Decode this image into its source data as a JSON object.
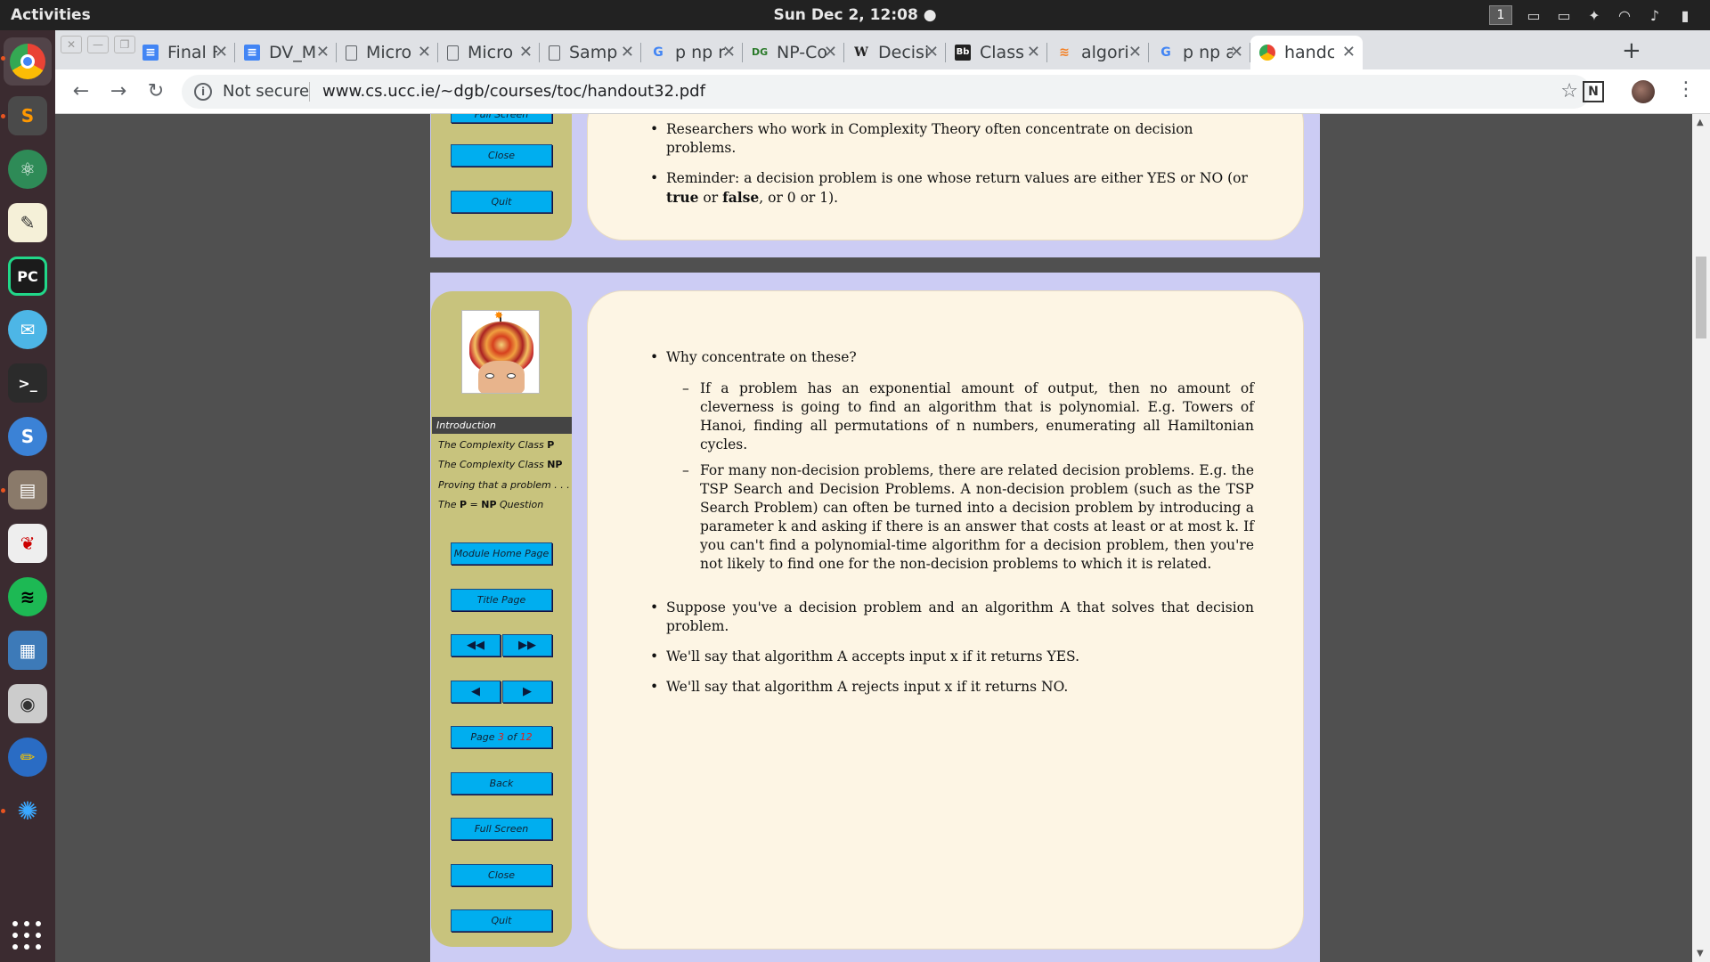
{
  "system": {
    "activities": "Activities",
    "clock": "Sun Dec  2, 12:08 ●",
    "workspace": "1"
  },
  "dock": {
    "apps": [
      "chrome-icon",
      "sublime-icon",
      "atom-icon",
      "text-editor-icon",
      "pycharm-icon",
      "mail-icon",
      "terminal-icon",
      "simplenote-icon",
      "files-icon",
      "evince-icon",
      "spotify-icon",
      "image-viewer-icon",
      "screenshot-icon",
      "pencil-icon",
      "settings-icon"
    ]
  },
  "browser": {
    "tabs": [
      {
        "title": "Final F",
        "icon": "docs-icon"
      },
      {
        "title": "DV_M",
        "icon": "docs-icon"
      },
      {
        "title": "Micro",
        "icon": "file-icon"
      },
      {
        "title": "Micro",
        "icon": "file-icon"
      },
      {
        "title": "Sampl",
        "icon": "file-icon"
      },
      {
        "title": "p np n",
        "icon": "google-icon"
      },
      {
        "title": "NP-Co",
        "icon": "dg-icon"
      },
      {
        "title": "Decisi",
        "icon": "wikipedia-icon"
      },
      {
        "title": "Class",
        "icon": "blackboard-icon"
      },
      {
        "title": "algori",
        "icon": "stack-icon"
      },
      {
        "title": "p np a",
        "icon": "google-icon"
      },
      {
        "title": "handc",
        "icon": "chrome-page-icon",
        "active": true
      }
    ],
    "not_secure": "Not secure",
    "url": "www.cs.ucc.ie/~dgb/courses/toc/handout32.pdf",
    "extension_label": "N"
  },
  "page1": {
    "buttons": {
      "full_screen": "Full Screen",
      "close": "Close",
      "quit": "Quit"
    },
    "bullets": [
      "Researchers who work in Complexity Theory often concentrate on decision problems.",
      "Reminder: a decision problem is one whose return values are either YES or NO (or",
      "true",
      " or ",
      "false",
      ", or 0 or 1)."
    ]
  },
  "page2": {
    "toc": {
      "selected": "Introduction",
      "items": [
        "The Complexity Class ",
        "P",
        "The Complexity Class ",
        "NP",
        "Proving that a problem . . .",
        "The ",
        "P",
        " = ",
        "NP",
        " Question"
      ]
    },
    "buttons": {
      "module_home": "Module Home Page",
      "title_page": "Title Page",
      "rewind": "◀◀",
      "fast_forward": "▶▶",
      "prev": "◀",
      "next": "▶",
      "page_prefix": "Page ",
      "page_num": "3",
      "page_of": " of ",
      "page_total": "12",
      "back": "Back",
      "full_screen": "Full Screen",
      "close": "Close",
      "quit": "Quit"
    },
    "content": {
      "q": "Why concentrate on these?",
      "sub1": "If a problem has an exponential amount of output, then no amount of cleverness is going to find an algorithm that is polynomial. E.g. Towers of Hanoi, finding all permutations of n numbers, enumerating all Hamiltonian cycles.",
      "sub2": "For many non-decision problems, there are related decision problems. E.g. the TSP Search and Decision Problems. A non-decision problem (such as the TSP Search Problem) can often be turned into a decision problem by introducing a parameter k and asking if there is an answer that costs at least or at most k. If you can't find a polynomial-time algorithm for a decision problem, then you're not likely to find one for the non-decision problems to which it is related.",
      "b2": "Suppose you've a decision problem and an algorithm A that solves that decision problem.",
      "b3": "We'll say that algorithm A accepts input x if it returns YES.",
      "b4": "We'll say that algorithm A rejects input x if it returns NO."
    }
  }
}
